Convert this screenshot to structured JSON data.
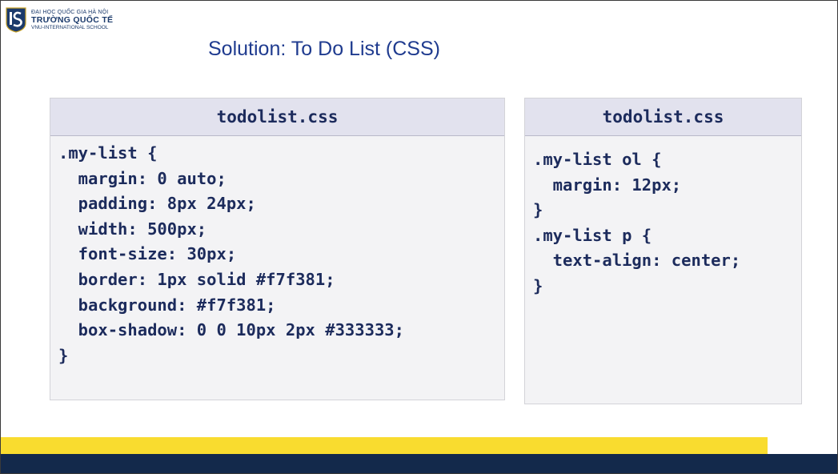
{
  "logo": {
    "line1": "ĐẠI HỌC QUỐC GIA HÀ NỘI",
    "line2": "TRƯỜNG QUỐC TẾ",
    "line3": "VNU-INTERNATIONAL SCHOOL"
  },
  "title": "Solution: To Do List (CSS)",
  "code_left": {
    "filename": "todolist.css",
    "lines": [
      ".my-list {",
      "  margin: 0 auto;",
      "  padding: 8px 24px;",
      "  width: 500px;",
      "  font-size: 30px;",
      "  border: 1px solid #f7f381;",
      "  background: #f7f381;",
      "  box-shadow: 0 0 10px 2px #333333;",
      "}"
    ]
  },
  "code_right": {
    "filename": "todolist.css",
    "lines": [
      ".my-list ol {",
      "  margin: 12px;",
      "}",
      ".my-list p {",
      "  text-align: center;",
      "}"
    ]
  },
  "colors": {
    "title": "#1f3b8f",
    "code_text": "#1c2b5c",
    "accent_yellow": "#f9dc2f",
    "footer_navy": "#13294b"
  }
}
